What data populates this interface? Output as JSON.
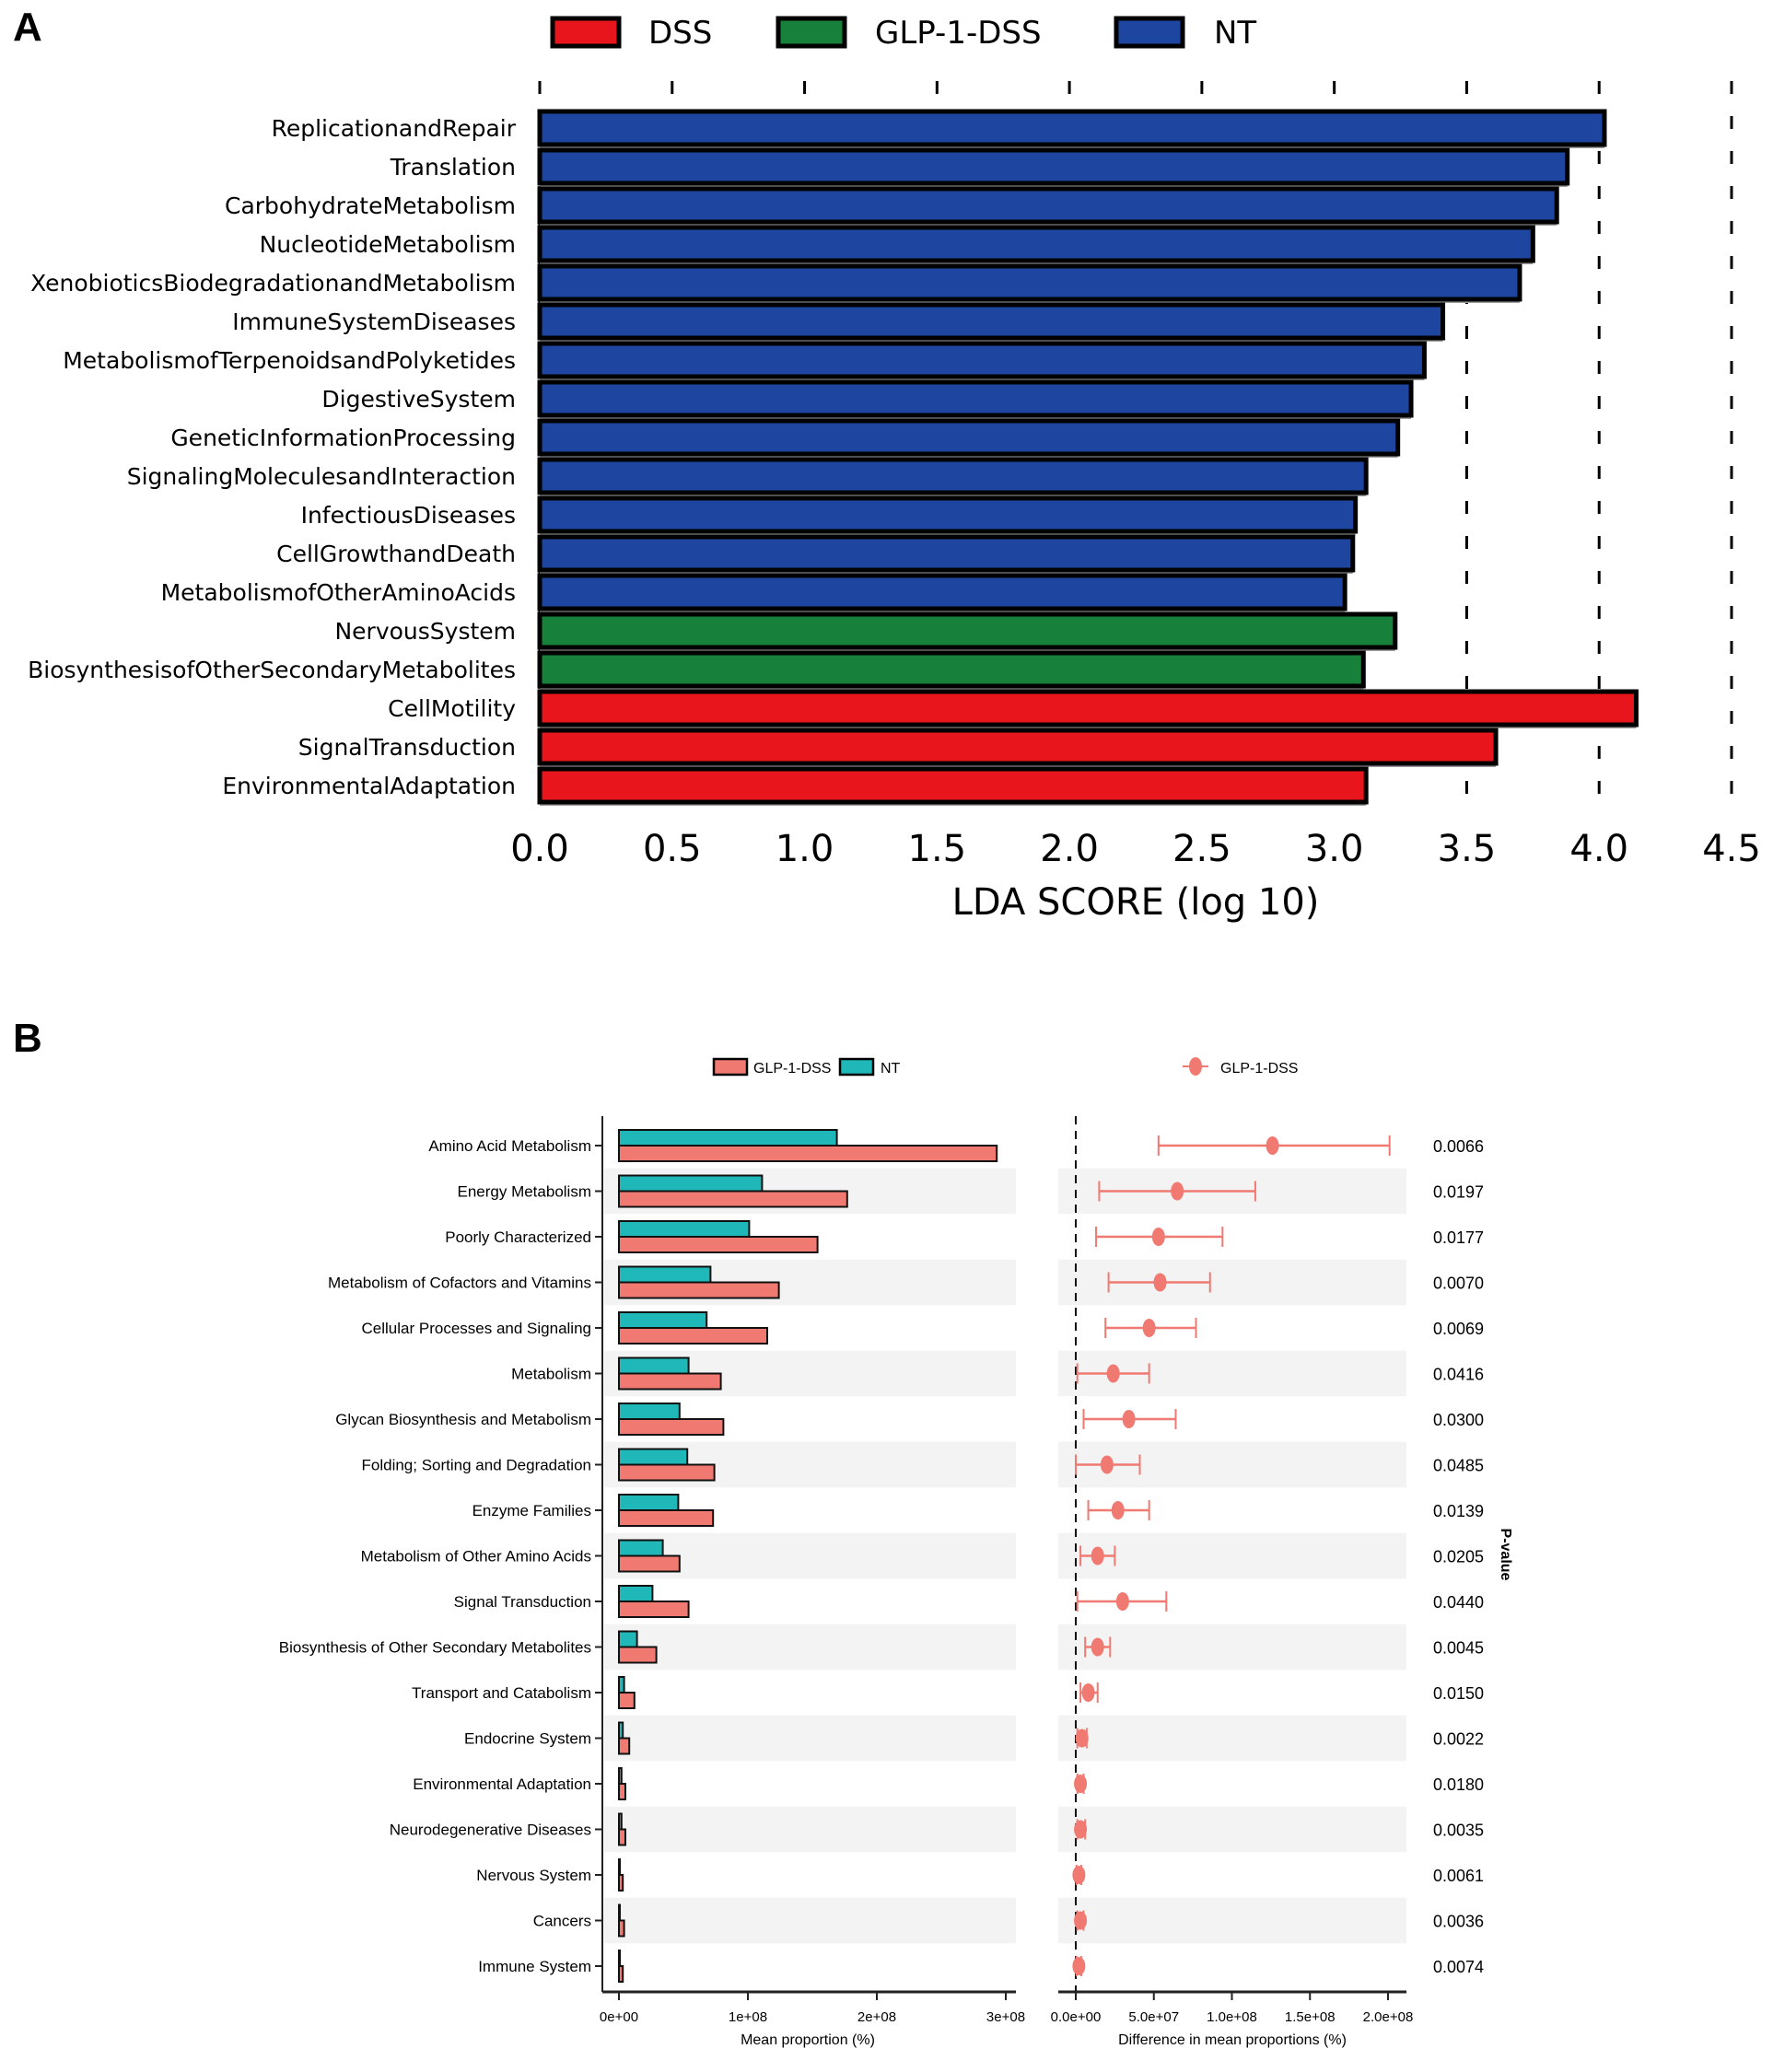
{
  "panels": {
    "a_letter": "A",
    "b_letter": "B"
  },
  "chart_data": [
    {
      "panel": "A",
      "type": "bar",
      "orientation": "horizontal",
      "title": "",
      "xlabel": "LDA SCORE (log 10)",
      "ylabel": "",
      "xlim": [
        0,
        4.5
      ],
      "xticks": [
        "0.0",
        "0.5",
        "1.0",
        "1.5",
        "2.0",
        "2.5",
        "3.0",
        "3.5",
        "4.0",
        "4.5"
      ],
      "grid": "vertical dashed",
      "legend_position": "top",
      "legend": [
        {
          "name": "DSS",
          "color": "#e8161c"
        },
        {
          "name": "GLP-1-DSS",
          "color": "#17803a"
        },
        {
          "name": "NT",
          "color": "#1e46a0"
        }
      ],
      "categories": [
        "ReplicationandRepair",
        "Translation",
        "CarbohydrateMetabolism",
        "NucleotideMetabolism",
        "XenobioticsBiodegradationandMetabolism",
        "ImmuneSystemDiseases",
        "MetabolismofTerpenoidsandPolyketides",
        "DigestiveSystem",
        "GeneticInformationProcessing",
        "SignalingMoleculesandInteraction",
        "InfectiousDiseases",
        "CellGrowthandDeath",
        "MetabolismofOtherAminoAcids",
        "NervousSystem",
        "BiosynthesisofOtherSecondaryMetabolites",
        "CellMotility",
        "SignalTransduction",
        "EnvironmentalAdaptation"
      ],
      "groups": [
        "NT",
        "NT",
        "NT",
        "NT",
        "NT",
        "NT",
        "NT",
        "NT",
        "NT",
        "NT",
        "NT",
        "NT",
        "NT",
        "GLP-1-DSS",
        "GLP-1-DSS",
        "DSS",
        "DSS",
        "DSS"
      ],
      "values": [
        4.02,
        3.88,
        3.84,
        3.75,
        3.7,
        3.41,
        3.34,
        3.29,
        3.24,
        3.12,
        3.08,
        3.07,
        3.04,
        3.23,
        3.11,
        4.14,
        3.61,
        3.12
      ]
    },
    {
      "panel": "B-left",
      "type": "bar",
      "orientation": "horizontal",
      "xlabel": "Mean proportion (%)",
      "ylabel": "",
      "xlim": [
        0,
        300000000
      ],
      "xticks": [
        "0e+00",
        "1e+08",
        "2e+08",
        "3e+08"
      ],
      "xtick_values": [
        0,
        100000000,
        200000000,
        300000000
      ],
      "legend_position": "top",
      "legend": [
        {
          "name": "GLP-1-DSS",
          "color": "#f07a72"
        },
        {
          "name": "NT",
          "color": "#1fb7b7"
        }
      ],
      "categories": [
        "Amino Acid Metabolism",
        "Energy Metabolism",
        "Poorly Characterized",
        "Metabolism of Cofactors and Vitamins",
        "Cellular Processes and Signaling",
        "Metabolism",
        "Glycan Biosynthesis and Metabolism",
        "Folding; Sorting and Degradation",
        "Enzyme Families",
        "Metabolism of Other Amino Acids",
        "Signal Transduction",
        "Biosynthesis of Other Secondary Metabolites",
        "Transport and Catabolism",
        "Endocrine System",
        "Environmental Adaptation",
        "Neurodegenerative Diseases",
        "Nervous System",
        "Cancers",
        "Immune System"
      ],
      "series": [
        {
          "name": "NT",
          "values": [
            169000000,
            111000000,
            101000000,
            71000000,
            68000000,
            54000000,
            47000000,
            53000000,
            46000000,
            34000000,
            26000000,
            14000000,
            4000000,
            3000000,
            2000000,
            2000000,
            500000,
            500000,
            500000
          ]
        },
        {
          "name": "GLP-1-DSS",
          "values": [
            293000000,
            177000000,
            154000000,
            124000000,
            115000000,
            79000000,
            81000000,
            74000000,
            73000000,
            47000000,
            54000000,
            29000000,
            12000000,
            8000000,
            5000000,
            5000000,
            3000000,
            4000000,
            3000000
          ]
        }
      ]
    },
    {
      "panel": "B-right",
      "type": "scatter",
      "subtype": "errorbar",
      "xlabel": "Difference in mean proportions (%)",
      "ylabel": "P-value",
      "xlim": [
        0,
        200000000
      ],
      "xticks": [
        "0.0e+00",
        "5.0e+07",
        "1.0e+08",
        "1.5e+08",
        "2.0e+08"
      ],
      "xtick_values": [
        0,
        50000000,
        100000000,
        150000000,
        200000000
      ],
      "legend_position": "top",
      "legend": [
        {
          "name": "GLP-1-DSS",
          "color": "#f07a72"
        }
      ],
      "reference_line": 0,
      "points": [
        {
          "diff": 126000000,
          "ci_low": 53000000,
          "ci_high": 201000000,
          "p_value": "0.0066"
        },
        {
          "diff": 65000000,
          "ci_low": 15000000,
          "ci_high": 115000000,
          "p_value": "0.0197"
        },
        {
          "diff": 53000000,
          "ci_low": 13000000,
          "ci_high": 94000000,
          "p_value": "0.0177"
        },
        {
          "diff": 54000000,
          "ci_low": 21000000,
          "ci_high": 86000000,
          "p_value": "0.0070"
        },
        {
          "diff": 47000000,
          "ci_low": 19000000,
          "ci_high": 77000000,
          "p_value": "0.0069"
        },
        {
          "diff": 24000000,
          "ci_low": 1000000,
          "ci_high": 47000000,
          "p_value": "0.0416"
        },
        {
          "diff": 34000000,
          "ci_low": 5000000,
          "ci_high": 64000000,
          "p_value": "0.0300"
        },
        {
          "diff": 20000000,
          "ci_low": 0,
          "ci_high": 41000000,
          "p_value": "0.0485"
        },
        {
          "diff": 27000000,
          "ci_low": 8000000,
          "ci_high": 47000000,
          "p_value": "0.0139"
        },
        {
          "diff": 14000000,
          "ci_low": 3000000,
          "ci_high": 25000000,
          "p_value": "0.0205"
        },
        {
          "diff": 30000000,
          "ci_low": 1000000,
          "ci_high": 58000000,
          "p_value": "0.0440"
        },
        {
          "diff": 14000000,
          "ci_low": 6000000,
          "ci_high": 22000000,
          "p_value": "0.0045"
        },
        {
          "diff": 8000000,
          "ci_low": 3000000,
          "ci_high": 14000000,
          "p_value": "0.0150"
        },
        {
          "diff": 4000000,
          "ci_low": 1000000,
          "ci_high": 7000000,
          "p_value": "0.0022"
        },
        {
          "diff": 3000000,
          "ci_low": 1000000,
          "ci_high": 5000000,
          "p_value": "0.0180"
        },
        {
          "diff": 3000000,
          "ci_low": 1000000,
          "ci_high": 6000000,
          "p_value": "0.0035"
        },
        {
          "diff": 2000000,
          "ci_low": 500000,
          "ci_high": 3500000,
          "p_value": "0.0061"
        },
        {
          "diff": 3000000,
          "ci_low": 1000000,
          "ci_high": 5000000,
          "p_value": "0.0036"
        },
        {
          "diff": 2000000,
          "ci_low": 500000,
          "ci_high": 3500000,
          "p_value": "0.0074"
        }
      ]
    }
  ]
}
